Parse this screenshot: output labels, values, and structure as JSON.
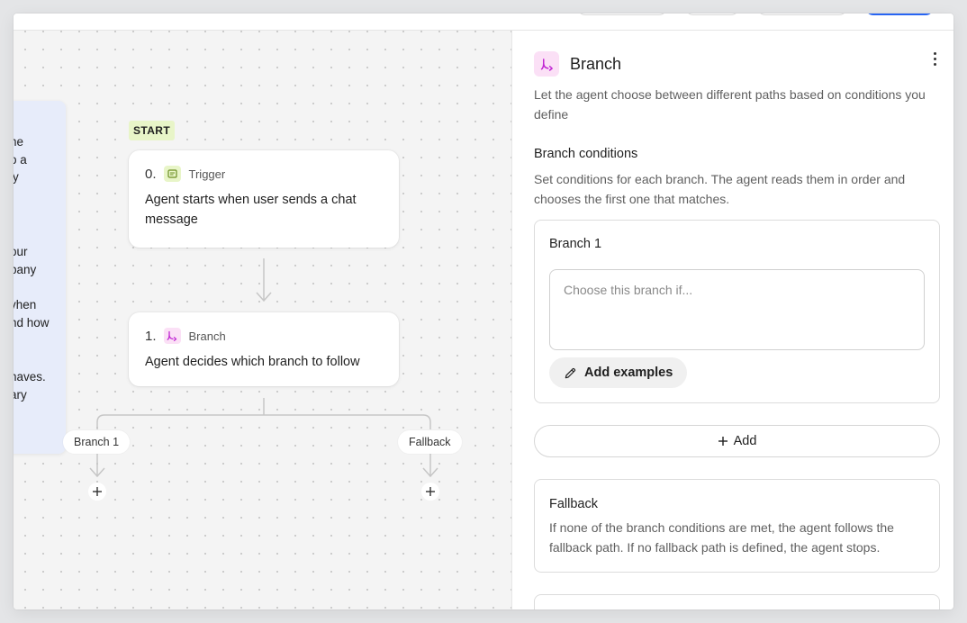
{
  "canvas": {
    "side_panel_lines": [
      "he",
      "o a",
      "ly",
      "our",
      "pany",
      "vhen",
      "nd how",
      "haves.",
      "ary"
    ],
    "start_badge": "START",
    "trigger_node": {
      "number": "0.",
      "type": "Trigger",
      "text": "Agent starts when user sends a chat message",
      "icon": "chat-icon"
    },
    "branch_node": {
      "number": "1.",
      "type": "Branch",
      "text": "Agent decides which branch to follow",
      "icon": "branch-icon"
    },
    "edge_labels": [
      "Branch 1",
      "Fallback"
    ]
  },
  "panel": {
    "title": "Branch",
    "icon": "branch-icon",
    "description": "Let the agent choose between different paths based on conditions you define",
    "conditions_title": "Branch conditions",
    "conditions_description": "Set conditions for each branch. The agent reads them in order and chooses the first one that matches.",
    "branch_card": {
      "title": "Branch 1",
      "input_placeholder": "Choose this branch if...",
      "input_value": "",
      "examples_button": "Add examples"
    },
    "add_button": "Add",
    "fallback_card": {
      "title": "Fallback",
      "description": "If none of the branch conditions are met, the agent follows the fallback path. If no fallback path is defined, the agent stops."
    }
  },
  "colors": {
    "accent": "#2764f2",
    "trigger_icon_bg": "#e8f5c8",
    "branch_icon_bg": "#fbe0f6",
    "branch_icon_fg": "#c026d3",
    "trigger_icon_fg": "#6b8e23"
  }
}
